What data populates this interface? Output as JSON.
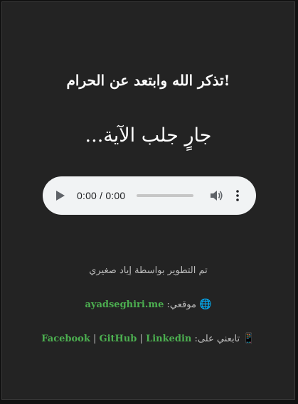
{
  "heading": "!تذكر الله وابتعد عن الحرام",
  "loading_text": "جارٍ جلب الآية...",
  "audio_player": {
    "time_display": "0:00 / 0:00",
    "progress": 0,
    "icons": [
      "play-icon",
      "volume-icon",
      "more-options-icon"
    ]
  },
  "footer": {
    "credit_prefix": "تم التطوير بواسطة",
    "credit_name": "إياد صغيري",
    "site_label": "موقعي:",
    "site_icon": "🌐",
    "site_link": "ayadseghiri.me",
    "social_icon": "📱",
    "social_label": "تابعني على:",
    "social_links": [
      "Facebook",
      "GitHub",
      "Linkedin"
    ],
    "separator": "|"
  },
  "colors": {
    "background": "#232323",
    "link_green": "#4caf50",
    "player_bg": "#f1f3f4",
    "text": "#ffffff"
  }
}
